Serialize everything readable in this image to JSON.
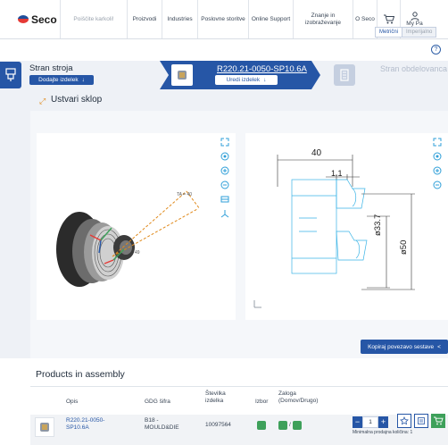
{
  "colors": {
    "accent": "#2656a6",
    "brand_red": "#e53935",
    "success": "#3ea05a",
    "orange": "#e08a1c",
    "drawing_blue": "#3ab4e6"
  },
  "nav": {
    "logo": "Seco",
    "search_placeholder": "Poiščite karkoli!",
    "items": [
      "Proizvodi",
      "Industries",
      "Poslovne storitve",
      "Online Support",
      "Znanje in izobraževanje",
      "O Seco"
    ],
    "cart_icon": "cart-icon",
    "my_page": "My Pa"
  },
  "help_icon_label": "?",
  "steps": {
    "step1": {
      "title": "Stran stroja",
      "button": "Dodajte izdelek"
    },
    "step2": {
      "title": "R220.21-0050-SP10.6A",
      "button": "Uredi izdelek"
    },
    "step3": {
      "title": "Stran obdelovanca"
    }
  },
  "assembly": {
    "title": "Ustvari sklop",
    "units": [
      "Metrični",
      "Imperijalno"
    ],
    "view3d": {
      "annotation1": "TA = 40",
      "annotation2": "49"
    },
    "drawing": {
      "dim_top": "40",
      "dim_small": "1.1",
      "dim_d1": "ø33.7",
      "dim_d2": "ø50"
    },
    "copy_button": "Kopiraj povezavo sestave"
  },
  "products": {
    "title": "Products in assembly",
    "columns": [
      "Opis",
      "GDG šifra",
      "Številka izdelka",
      "Izbor",
      "Zaloga (Domov/Drugo)"
    ],
    "row": {
      "description": "R220.21-0050-SP10.6A",
      "gdg": "B18 - MOULD&DIE",
      "number": "10097564",
      "stock_separator": "/",
      "quantity": "1",
      "min_qty": "Minimalna prodajna količina: 1"
    }
  }
}
